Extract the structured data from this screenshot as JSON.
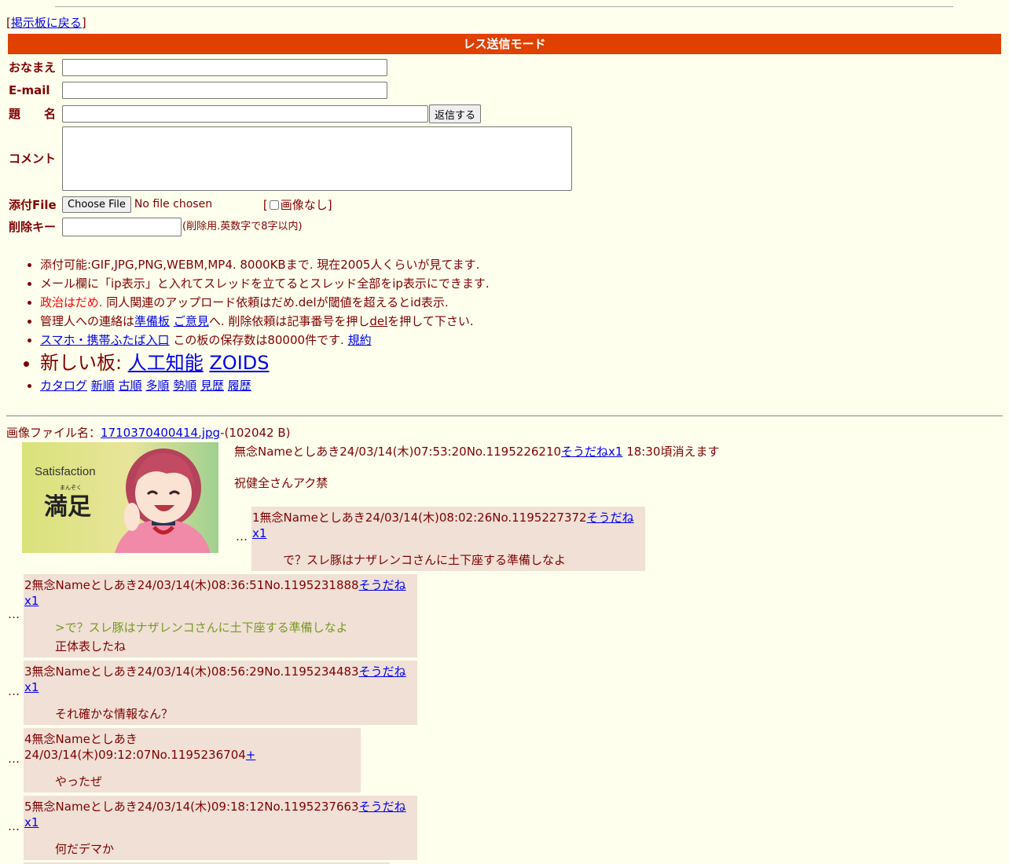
{
  "nav": {
    "back_bracket_open": "[",
    "back_label": "掲示板に戻る",
    "back_bracket_close": "]"
  },
  "mode_bar": "レス送信モード",
  "form": {
    "name_label": "おなまえ",
    "email_label": "E-mail",
    "subject_label": "題　　名",
    "submit_label": "返信する",
    "comment_label": "コメント",
    "file_label": "添付File",
    "choose_file_label": "Choose File",
    "no_file_text": "No file chosen",
    "no_image_open": "[",
    "no_image_label": "画像なし",
    "no_image_close": "]",
    "delkey_label": "削除キー",
    "delkey_note": "(削除用.英数字で8字以内)"
  },
  "rules": {
    "line1": "添付可能:GIF,JPG,PNG,WEBM,MP4. 8000KBまで. 現在2005人くらいが見てます.",
    "line2": "メール欄に「ip表示」と入れてスレッドを立てるとスレッド全部をip表示にできます.",
    "line3_red": "政治はだめ.",
    "line3_rest": " 同人関連のアップロード依頼はだめ.delが閾値を超えるとid表示.",
    "line4_a": "管理人への連絡は",
    "line4_link1": "準備板",
    "line4_link2": "ご意見",
    "line4_b": "へ. 削除依頼は記事番号を押し",
    "line4_del": "del",
    "line4_c": "を押して下さい.",
    "line5_link": "スマホ・携帯ふたば入口",
    "line5_text": " この板の保存数は80000件です. ",
    "line5_rules": "規約",
    "line6_text": "新しい板: ",
    "line6_link1": "人工知能",
    "line6_link2": "ZOIDS",
    "sort_links": [
      "カタログ",
      "新順",
      "古順",
      "多順",
      "勢順",
      "見歴",
      "履歴"
    ]
  },
  "op": {
    "file_prefix": "画像ファイル名：",
    "file_name": "1710370400414.jpg",
    "file_size": "-(102042 B)",
    "thumb_text1": "Satisfaction",
    "thumb_text2": "満足",
    "thumb_ruby": "まんぞく",
    "header": "無念Nameとしあき24/03/14(木)07:53:20No.1195226210",
    "soudane": "そうだねx1",
    "expire": " 18:30頃消えます",
    "body": "祝健全さんアク禁"
  },
  "replies": [
    {
      "header": "1無念Nameとしあき24/03/14(木)08:02:26No.1195227372",
      "soudane": "そうだねx1",
      "quote": "",
      "body": "で？スレ豚はナザレンコさんに土下座する準備しなよ"
    },
    {
      "header": "2無念Nameとしあき24/03/14(木)08:36:51No.1195231888",
      "soudane": "そうだねx1",
      "quote": ">で？スレ豚はナザレンコさんに土下座する準備しなよ",
      "body": "正体表したね"
    },
    {
      "header": "3無念Nameとしあき24/03/14(木)08:56:29No.1195234483",
      "soudane": "そうだねx1",
      "quote": "",
      "body": "それ確かな情報なん？"
    },
    {
      "header": "4無念Nameとしあき24/03/14(木)09:12:07No.1195236704",
      "soudane": "+",
      "quote": "",
      "body": "やったぜ"
    },
    {
      "header": "5無念Nameとしあき24/03/14(木)09:18:12No.1195237663",
      "soudane": "そうだねx1",
      "quote": "",
      "body": "何だデマか"
    }
  ],
  "ellipsis": "…",
  "colors": {
    "background": "#ffffee",
    "text": "#800000",
    "mode_bar": "#e04000",
    "reply_bg": "#f0e0d6",
    "quote": "#789922",
    "link": "#0000ee"
  }
}
